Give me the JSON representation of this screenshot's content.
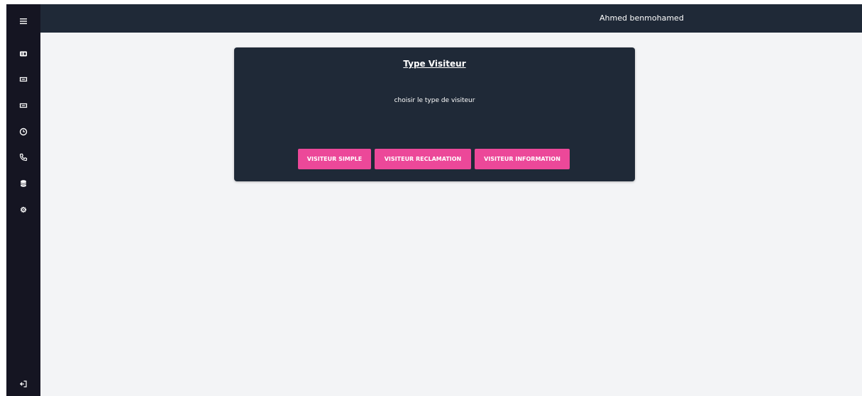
{
  "header": {
    "user_name": "Ahmed benmohamed"
  },
  "sidebar": {
    "icons": [
      "menu-icon",
      "id-card-icon",
      "ticket-icon",
      "ticket-icon",
      "clock-icon",
      "phone-icon",
      "database-icon",
      "gear-icon",
      "logout-icon"
    ]
  },
  "card": {
    "title": "Type Visiteur",
    "description": "choisir le type de visiteur",
    "buttons": [
      "VISITEUR SIMPLE",
      "VISITEUR RECLAMATION",
      "VISITEUR INFORMATION"
    ]
  },
  "colors": {
    "sidebar_bg": "#151522",
    "topbar_bg": "#1f2937",
    "card_bg": "#1f2937",
    "page_bg": "#f3f4f6",
    "button_bg": "#ec4899"
  }
}
